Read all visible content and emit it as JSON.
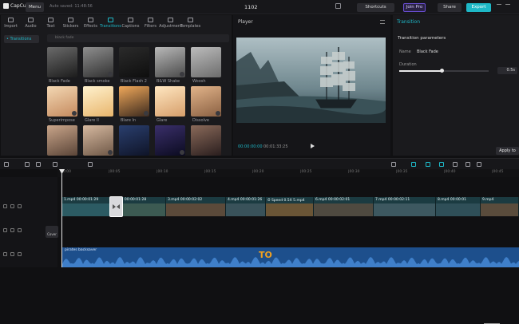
{
  "app": {
    "name": "CapCut",
    "menu": "Menu",
    "autosave": "Auto saved: 11:48:56",
    "project_title": "1102",
    "shortcuts": "Shortcuts",
    "join_pro": "Join Pro",
    "share": "Share",
    "export": "Export"
  },
  "toolbar": [
    "Import",
    "Audio",
    "Text",
    "Stickers",
    "Effects",
    "Transitions",
    "Captions",
    "Filters",
    "Adjustment",
    "Templates"
  ],
  "sidebar": {
    "item": "• Transitions"
  },
  "search": {
    "placeholder": "black fade"
  },
  "transitions": [
    {
      "label": "Black Fade",
      "c1": "#6b6b6b",
      "c2": "#1c1c1c"
    },
    {
      "label": "Black smoke",
      "c1": "#8f8f8f",
      "c2": "#303030"
    },
    {
      "label": "Black Flash 2",
      "c1": "#2b2b2b",
      "c2": "#0e0e0e"
    },
    {
      "label": "B&W Shake",
      "c1": "#b9b9b9",
      "c2": "#4a4a4a"
    },
    {
      "label": "Woosh",
      "c1": "#bcbcbc",
      "c2": "#6c6c6c"
    },
    {
      "label": "Superimpose",
      "c1": "#f3d8b4",
      "c2": "#c58a5e"
    },
    {
      "label": "Glare II",
      "c1": "#fff2cf",
      "c2": "#e8b56c"
    },
    {
      "label": "Blare In",
      "c1": "#f0a85a",
      "c2": "#3c2a1e"
    },
    {
      "label": "Glare",
      "c1": "#ffe7c2",
      "c2": "#d69e6a"
    },
    {
      "label": "Dissolve",
      "c1": "#e2b48a",
      "c2": "#8a6042"
    },
    {
      "label": "",
      "c1": "#c9a58a",
      "c2": "#5b4538"
    },
    {
      "label": "",
      "c1": "#d6b9a0",
      "c2": "#6f5847"
    },
    {
      "label": "",
      "c1": "#2a3f6e",
      "c2": "#0f1428"
    },
    {
      "label": "",
      "c1": "#3a2f6a",
      "c2": "#0b0b20"
    },
    {
      "label": "",
      "c1": "#8a6a5a",
      "c2": "#2a1e1e"
    }
  ],
  "player": {
    "title": "Player",
    "time_current": "00:00:00:00",
    "time_total": "00:01:33:25"
  },
  "transition_panel": {
    "title": "Transition",
    "section": "Transition parameters",
    "name_label": "Name",
    "name_value": "Black Fade",
    "duration_label": "Duration",
    "duration_value": "0.5s",
    "duration_fraction": 0.48,
    "apply_all": "Apply to"
  },
  "ruler": [
    "00:00",
    "|00:05",
    "|00:10",
    "|00:15",
    "|00:20",
    "|00:25",
    "|00:30",
    "|00:35",
    "|00:40",
    "|00:45"
  ],
  "track": {
    "cover": "Cover"
  },
  "clips": [
    {
      "label": "1.mp4  00:00:01:29",
      "color": "#2c5b63"
    },
    {
      "label": "2.mp4  00:00:01:28",
      "color": "#3c5a52"
    },
    {
      "label": "3.mp4  00:00:02:02",
      "color": "#5b4a3a"
    },
    {
      "label": "4.mp4  00:00:01:26",
      "color": "#39525a"
    },
    {
      "label": "⏱ Speed 0.5X  5.mp4",
      "color": "#6a5536"
    },
    {
      "label": "6.mp4  00:00:02:01",
      "color": "#4f4a40"
    },
    {
      "label": "7.mp4  00:00:02:11",
      "color": "#3d5860"
    },
    {
      "label": "8.mp4  00:00:01",
      "color": "#2f4f58"
    },
    {
      "label": "9.mp4",
      "color": "#5a4c3c"
    }
  ],
  "audio": {
    "label": "pirates backsaver"
  },
  "caption_word": "TO",
  "colors": {
    "accent": "#1eb8c7",
    "audio": "#1d4f8c",
    "video": "#1c3d44"
  }
}
